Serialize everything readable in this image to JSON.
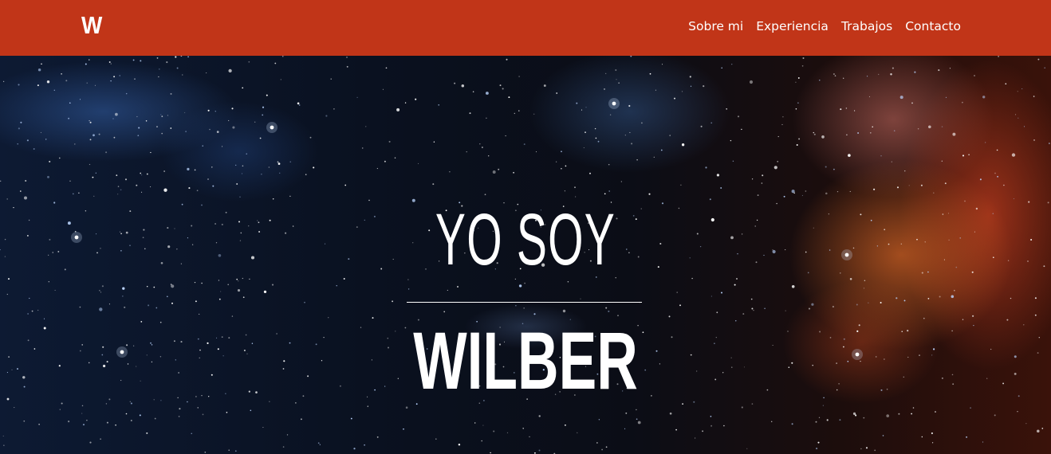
{
  "header": {
    "logo_text": "W",
    "bg_color": "#c13518",
    "nav": [
      {
        "label": "Sobre mi"
      },
      {
        "label": "Experiencia"
      },
      {
        "label": "Trabajos"
      },
      {
        "label": "Contacto"
      }
    ]
  },
  "hero": {
    "line1": "YO SOY",
    "line2": "WILBER",
    "background": "space-nebula-image"
  }
}
